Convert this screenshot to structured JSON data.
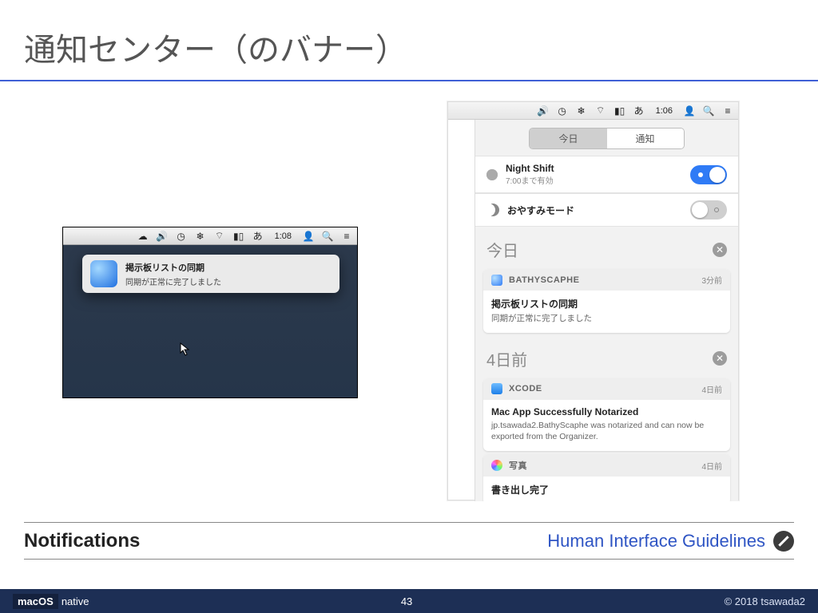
{
  "slide": {
    "title": "通知センター（のバナー）",
    "label_left": "Notifications",
    "label_right": "Human Interface Guidelines",
    "page_number": "43"
  },
  "footer": {
    "brand_box": "macOS",
    "brand_rest": "native",
    "copyright": "© 2018 tsawada2"
  },
  "banner": {
    "menubar_time": "1:08",
    "card_title": "掲示板リストの同期",
    "card_body": "同期が正常に完了しました"
  },
  "nc": {
    "menubar_time": "1:06",
    "seg_today": "今日",
    "seg_notifications": "通知",
    "night_shift": {
      "title": "Night Shift",
      "subtitle": "7:00まで有効"
    },
    "dnd": {
      "title": "おやすみモード"
    },
    "sections": [
      {
        "header": "今日",
        "items": [
          {
            "app": "BATHYSCAPHE",
            "time": "3分前",
            "title": "掲示板リストの同期",
            "body": "同期が正常に完了しました"
          }
        ]
      },
      {
        "header": "4日前",
        "items": [
          {
            "app": "XCODE",
            "time": "4日前",
            "title": "Mac App Successfully Notarized",
            "body": "jp.tsawada2.BathyScaphe was notarized and can now be exported from the Organizer."
          },
          {
            "app": "写真",
            "time": "4日前",
            "title": "書き出し完了",
            "body": ""
          }
        ]
      }
    ]
  }
}
